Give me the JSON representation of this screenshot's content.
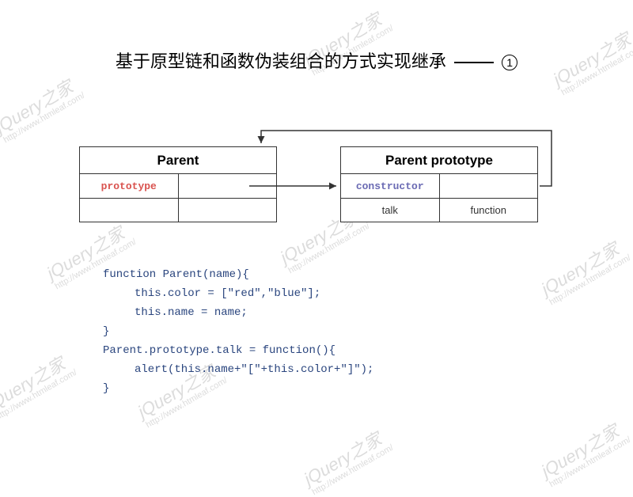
{
  "title": "基于原型链和函数伪装组合的方式实现继承",
  "title_number": "1",
  "watermark": {
    "title": "jQuery之家",
    "url": "http://www.htmleaf.com/"
  },
  "diagram": {
    "parent_box": {
      "header": "Parent",
      "row1": {
        "key": "prototype",
        "val": ""
      },
      "row2": {
        "key": "",
        "val": ""
      }
    },
    "proto_box": {
      "header": "Parent prototype",
      "row1": {
        "key": "constructor",
        "val": ""
      },
      "row2": {
        "key": "talk",
        "val": "function"
      }
    }
  },
  "code": {
    "l1": "function Parent(name){",
    "l2": "this.color = [\"red\",\"blue\"];",
    "l3": "this.name = name;",
    "l4": "}",
    "l5": "Parent.prototype.talk = function(){",
    "l6": "alert(this.name+\"[\"+this.color+\"]\");",
    "l7": "}"
  }
}
